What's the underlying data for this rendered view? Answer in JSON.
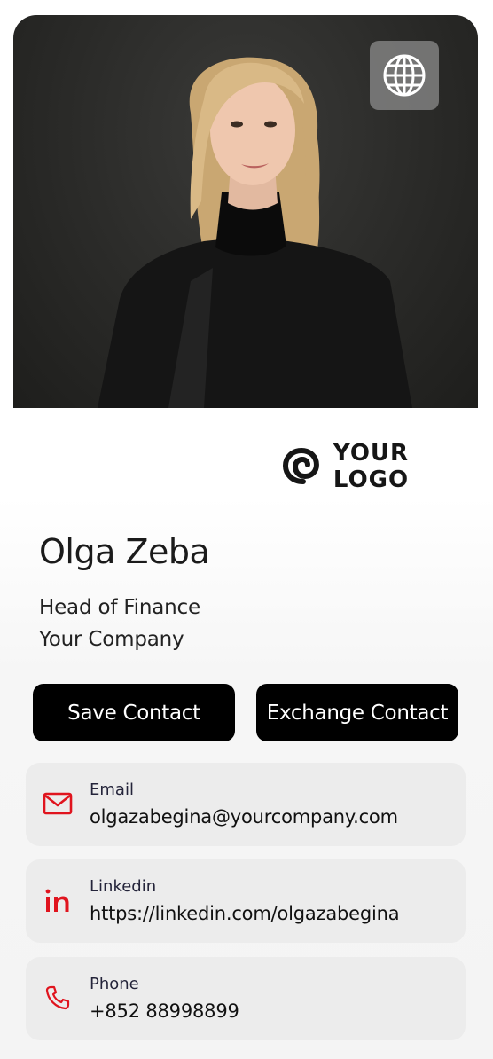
{
  "profile": {
    "photo_alt": "portrait-photo",
    "globe_icon": "globe-icon",
    "name": "Olga Zeba",
    "role": "Head of Finance",
    "company": "Your Company"
  },
  "logo": {
    "icon": "spiral-logo-icon",
    "text": "YOUR LOGO"
  },
  "actions": {
    "save_label": "Save Contact",
    "exchange_label": "Exchange Contact"
  },
  "contacts": [
    {
      "icon": "mail-icon",
      "label": "Email",
      "value": "olgazabegina@yourcompany.com"
    },
    {
      "icon": "linkedin-icon",
      "label": "Linkedin",
      "value": "https://linkedin.com/olgazabegina"
    },
    {
      "icon": "phone-icon",
      "label": "Phone",
      "value": "+852 88998899"
    }
  ],
  "colors": {
    "accent": "#e0141e",
    "button_bg": "#000000",
    "card_bg": "#ececec"
  }
}
